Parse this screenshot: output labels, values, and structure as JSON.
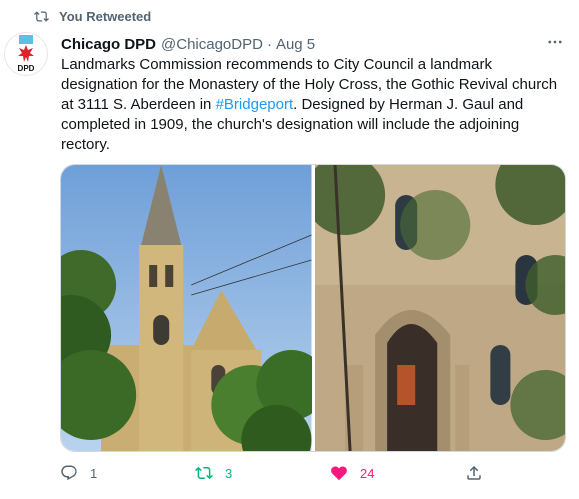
{
  "retweet_banner": {
    "icon": "retweet-icon",
    "label": "You Retweeted"
  },
  "tweet": {
    "author_name": "Chicago DPD",
    "author_handle": "@ChicagoDPD",
    "separator": "·",
    "date": "Aug 5",
    "text_before_hashtag": "Landmarks Commission recommends to City Council a landmark designation for the Monastery of the Holy Cross, the Gothic Revival church at 3111 S. Aberdeen in ",
    "hashtag": "#Bridgeport",
    "text_after_hashtag": ". Designed by Herman J. Gaul and completed in 1909, the church's designation will include the adjoining rectory.",
    "avatar": {
      "icon": "chicago-star-logo",
      "label": "DPD"
    },
    "media": [
      {
        "alt": "Gothic Revival church with tall steeple"
      },
      {
        "alt": "Rectory entrance with arched doorway"
      }
    ]
  },
  "actions": {
    "reply_count": "1",
    "retweet_count": "3",
    "like_count": "24"
  },
  "colors": {
    "accent": "#1d9bf0",
    "retweeted": "#00ba7c",
    "liked": "#f91880",
    "muted": "#536471"
  }
}
